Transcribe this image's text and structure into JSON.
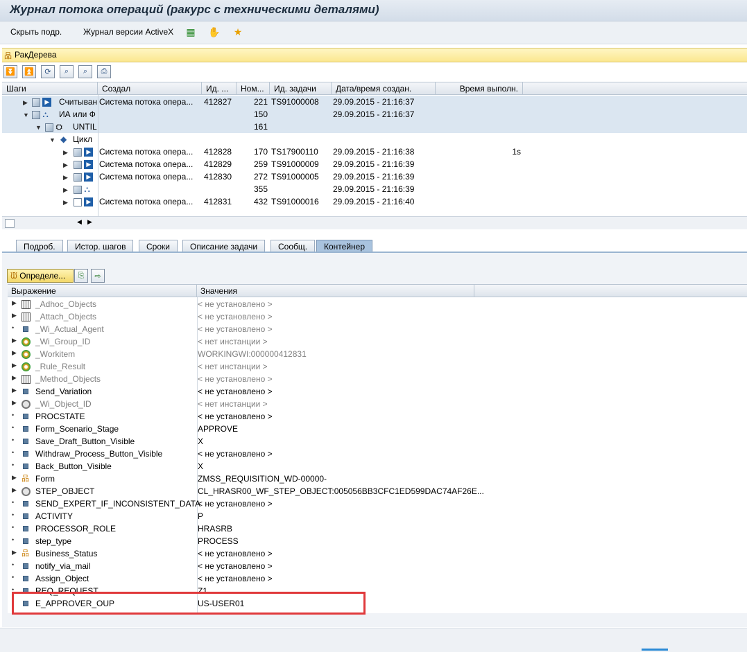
{
  "window": {
    "title": "Журнал потока операций (ракурс с техническими деталями)"
  },
  "toolbar": {
    "hide_label": "Скрыть подр.",
    "activex_label": "Журнал версии ActiveX"
  },
  "tree_bar": {
    "label": "РакДерева"
  },
  "grid1": {
    "columns": [
      "Шаги",
      "Создал",
      "Ид. ...",
      "Ном...",
      "Ид. задачи",
      "Дата/время создан.",
      "Время выполн."
    ],
    "rows": [
      {
        "step": "Считыван",
        "creator": "Система потока опера...",
        "id": "412827",
        "num": "221",
        "task": "TS91000008",
        "date": "29.09.2015 - 21:16:37",
        "time": ""
      },
      {
        "step": "ИА или Ф",
        "creator": "",
        "id": "",
        "num": "150",
        "task": "",
        "date": "29.09.2015 - 21:16:37",
        "time": ""
      },
      {
        "step": "UNTIL",
        "creator": "",
        "id": "",
        "num": "161",
        "task": "",
        "date": "",
        "time": ""
      },
      {
        "step": "Цикл",
        "creator": "",
        "id": "",
        "num": "",
        "task": "",
        "date": "",
        "time": ""
      },
      {
        "step": "",
        "creator": "Система потока опера...",
        "id": "412828",
        "num": "170",
        "task": "TS17900110",
        "date": "29.09.2015 - 21:16:38",
        "time": "1s"
      },
      {
        "step": "",
        "creator": "Система потока опера...",
        "id": "412829",
        "num": "259",
        "task": "TS91000009",
        "date": "29.09.2015 - 21:16:39",
        "time": ""
      },
      {
        "step": "",
        "creator": "Система потока опера...",
        "id": "412830",
        "num": "272",
        "task": "TS91000005",
        "date": "29.09.2015 - 21:16:39",
        "time": ""
      },
      {
        "step": "",
        "creator": "",
        "id": "",
        "num": "355",
        "task": "",
        "date": "29.09.2015 - 21:16:39",
        "time": ""
      },
      {
        "step": "",
        "creator": "Система потока опера...",
        "id": "412831",
        "num": "432",
        "task": "TS91000016",
        "date": "29.09.2015 - 21:16:40",
        "time": ""
      }
    ]
  },
  "tabs": [
    "Подроб.",
    "Истор. шагов",
    "Сроки",
    "Описание задачи",
    "Сообщ.",
    "Контейнер"
  ],
  "active_tab": "Контейнер",
  "container": {
    "define_button": "Определе...",
    "columns": [
      "Выражение",
      "Значения"
    ],
    "rows": [
      {
        "name": "_Adhoc_Objects",
        "value": "< не установлено >"
      },
      {
        "name": "_Attach_Objects",
        "value": "< не установлено >"
      },
      {
        "name": "_Wi_Actual_Agent",
        "value": "< не установлено >"
      },
      {
        "name": "_Wi_Group_ID",
        "value": "< нет инстанции >"
      },
      {
        "name": "_Workitem",
        "value": "WORKINGWI:000000412831"
      },
      {
        "name": "_Rule_Result",
        "value": "< нет инстанции >"
      },
      {
        "name": "_Method_Objects",
        "value": "< не установлено >"
      },
      {
        "name": "Send_Variation",
        "value": "< не установлено >"
      },
      {
        "name": "_Wi_Object_ID",
        "value": "< нет инстанции >"
      },
      {
        "name": "PROCSTATE",
        "value": "< не установлено >"
      },
      {
        "name": "Form_Scenario_Stage",
        "value": "APPROVE"
      },
      {
        "name": "Save_Draft_Button_Visible",
        "value": "X"
      },
      {
        "name": "Withdraw_Process_Button_Visible",
        "value": "< не установлено >"
      },
      {
        "name": "Back_Button_Visible",
        "value": "X"
      },
      {
        "name": "Form",
        "value": "ZMSS_REQUISITION_WD-00000-"
      },
      {
        "name": "STEP_OBJECT",
        "value": "CL_HRASR00_WF_STEP_OBJECT:005056BB3CFC1ED599DAC74AF26E..."
      },
      {
        "name": "SEND_EXPERT_IF_INCONSISTENT_DATA",
        "value": "< не установлено >"
      },
      {
        "name": "ACTIVITY",
        "value": "P"
      },
      {
        "name": "PROCESSOR_ROLE",
        "value": "HRASRB"
      },
      {
        "name": "step_type",
        "value": "PROCESS"
      },
      {
        "name": "Business_Status",
        "value": "< не установлено >"
      },
      {
        "name": "notify_via_mail",
        "value": "< не установлено >"
      },
      {
        "name": "Assign_Object",
        "value": "< не установлено >"
      },
      {
        "name": "REQ_REQUEST",
        "value": "Z1"
      },
      {
        "name": "E_APPROVER_OUP",
        "value": "US-USER01"
      }
    ]
  }
}
